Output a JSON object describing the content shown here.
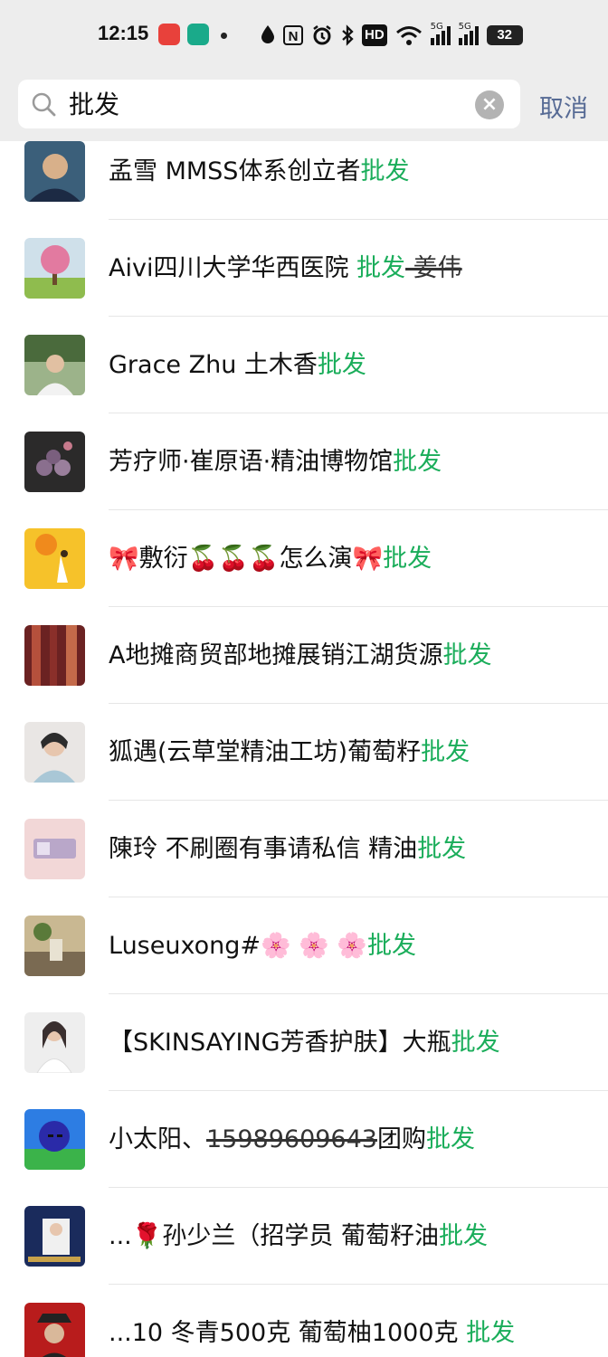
{
  "status_bar": {
    "time": "12:15",
    "icons": [
      "xiaohongshu-app-icon",
      "mi-home-app-icon",
      "notification-dot",
      "data-saver-icon",
      "nfc-icon",
      "alarm-icon",
      "bluetooth-icon",
      "hd-volte-icon",
      "wifi-icon",
      "signal-5g-icon",
      "signal-5g-icon",
      "battery-icon"
    ],
    "nfc_label": "N",
    "hd_label": "HD",
    "net1": "5G",
    "net2": "5G",
    "battery": "32"
  },
  "search": {
    "query": "批发",
    "cancel_label": "取消",
    "clear_symbol": "×"
  },
  "results": [
    {
      "name": "孟雪 MMSS体系创立者",
      "highlight": "批发",
      "strike": "",
      "tail": "",
      "avatar_colors": [
        "#1c2a44",
        "#d8b08a"
      ]
    },
    {
      "name": "Aivi四川大学华西医院 ",
      "highlight": "批发",
      "strike": " 姜伟",
      "tail": "",
      "avatar_colors": [
        "#e27aa0",
        "#8fbc4e"
      ]
    },
    {
      "name": "Grace Zhu 土木香",
      "highlight": "批发",
      "strike": "",
      "tail": "",
      "avatar_colors": [
        "#4a6a3c",
        "#9cb38a"
      ]
    },
    {
      "name": "芳疗师·崔原语·精油博物馆",
      "highlight": "批发",
      "strike": "",
      "tail": "",
      "avatar_colors": [
        "#2b2a2a",
        "#8a6f8e"
      ]
    },
    {
      "name": "🎀敷衍🍒🍒🍒怎么演🎀",
      "highlight": "批发",
      "strike": "",
      "tail": "",
      "avatar_colors": [
        "#f6c22a",
        "#f08a1c"
      ]
    },
    {
      "name": "A地摊商贸部地摊展销江湖货源",
      "highlight": "批发",
      "strike": "",
      "tail": "",
      "avatar_colors": [
        "#6b2222",
        "#b5503c"
      ]
    },
    {
      "name": "狐遇(云草堂精油工坊)葡萄籽",
      "highlight": "批发",
      "strike": "",
      "tail": "",
      "avatar_colors": [
        "#e9e6e4",
        "#2c2c2c"
      ]
    },
    {
      "name": "陳玲 不刷圈有事请私信 精油",
      "highlight": "批发",
      "strike": "",
      "tail": "",
      "avatar_colors": [
        "#f2d7d7",
        "#b9a7c9"
      ]
    },
    {
      "name": "Luseuxong#🌸 🌸 🌸",
      "highlight": "批发",
      "strike": "",
      "tail": "",
      "avatar_colors": [
        "#7a6a52",
        "#c9b892"
      ]
    },
    {
      "name": "【SKINSAYING芳香护肤】大瓶",
      "highlight": "批发",
      "strike": "",
      "tail": "",
      "avatar_colors": [
        "#eeeeee",
        "#3a2f2f"
      ]
    },
    {
      "name": "小太阳、",
      "highlight": "批发",
      "strike": "15989609643",
      "tail": "团购",
      "avatar_colors": [
        "#2d7de3",
        "#2a2aa8"
      ]
    },
    {
      "name": "...🌹孙少兰（招学员 葡萄籽油",
      "highlight": "批发",
      "strike": "",
      "tail": "",
      "avatar_colors": [
        "#1a2b5c",
        "#f0f0f0"
      ]
    },
    {
      "name": "...10 冬青500克 葡萄柚1000克 ",
      "highlight": "批发",
      "strike": "",
      "tail": "",
      "avatar_colors": [
        "#b81c1c",
        "#222222"
      ]
    }
  ]
}
